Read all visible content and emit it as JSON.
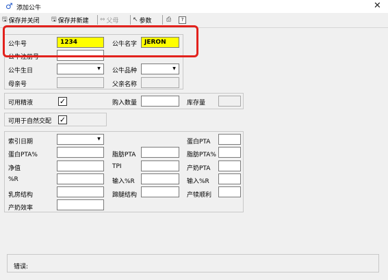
{
  "window": {
    "title": "添加公牛",
    "icon": "bull-male-symbol-icon",
    "close_label": "✕"
  },
  "toolbar": {
    "save_close": "保存并关闭",
    "save_new": "保存并新建",
    "sire": "父母",
    "params": "参数",
    "help": "?"
  },
  "basic": {
    "bull_no_label": "公牛号",
    "bull_no_value": "1234",
    "bull_name_label": "公牛名字",
    "bull_name_value": "JERON",
    "reg_no_label": "公牛注册号",
    "birth_label": "公牛生日",
    "breed_label": "公牛品种",
    "dam_no_label": "母亲号",
    "sire_name_label": "父亲名称"
  },
  "semen": {
    "usable_label": "可用精液",
    "usable_checked": true,
    "purchase_label": "购入数量",
    "stock_label": "库存量"
  },
  "natural": {
    "label": "可用于自然交配",
    "checked": true
  },
  "indices": {
    "index_date_label": "索引日期",
    "protein_pta_label": "蛋白PTA",
    "protein_pta_pct_label": "蛋白PTA%",
    "fat_pta_label": "脂肪PTA",
    "fat_pta_pct_label": "脂肪PTA%",
    "net_value_label": "净值",
    "tpi_label": "TPI",
    "milk_pta_label": "产奶PTA",
    "pct_r_label": "%R",
    "input_pct_r_label": "输入%R",
    "input_pct_r2_label": "输入%R",
    "udder_label": "乳房结构",
    "hoof_label": "蹄腿结构",
    "calving_ease_label": "产犊顺利",
    "milk_eff_label": "产奶效率"
  },
  "error": {
    "label": "错误:"
  }
}
